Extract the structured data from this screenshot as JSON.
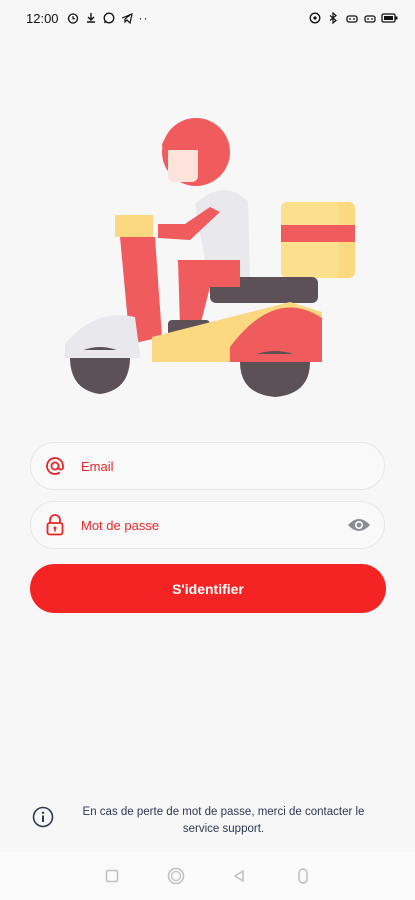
{
  "statusbar": {
    "time": "12:00",
    "dots": "··",
    "icons": [
      "alarm-icon",
      "download-icon",
      "whatsapp-icon",
      "telegram-icon",
      "location-icon",
      "bluetooth-icon",
      "android-icon",
      "android-icon",
      "battery-icon"
    ]
  },
  "hero": {
    "description_icon": "delivery-scooter-illustration"
  },
  "form": {
    "email": {
      "placeholder": "Email",
      "value": "",
      "icon": "at-icon"
    },
    "password": {
      "placeholder": "Mot de passe",
      "value": "",
      "icon": "lock-icon",
      "toggle_icon": "eye-icon"
    },
    "submit_label": "S'identifier"
  },
  "info": {
    "icon": "info-icon",
    "text": "En cas de perte de mot de passe, merci de contacter le service support."
  },
  "navbar": {
    "icons": [
      "square-icon",
      "home-circle-icon",
      "back-triangle-icon",
      "accessibility-icon"
    ]
  },
  "colors": {
    "accent": "#f42425",
    "text_dark": "#2e3756",
    "background": "#f7f7f7"
  }
}
